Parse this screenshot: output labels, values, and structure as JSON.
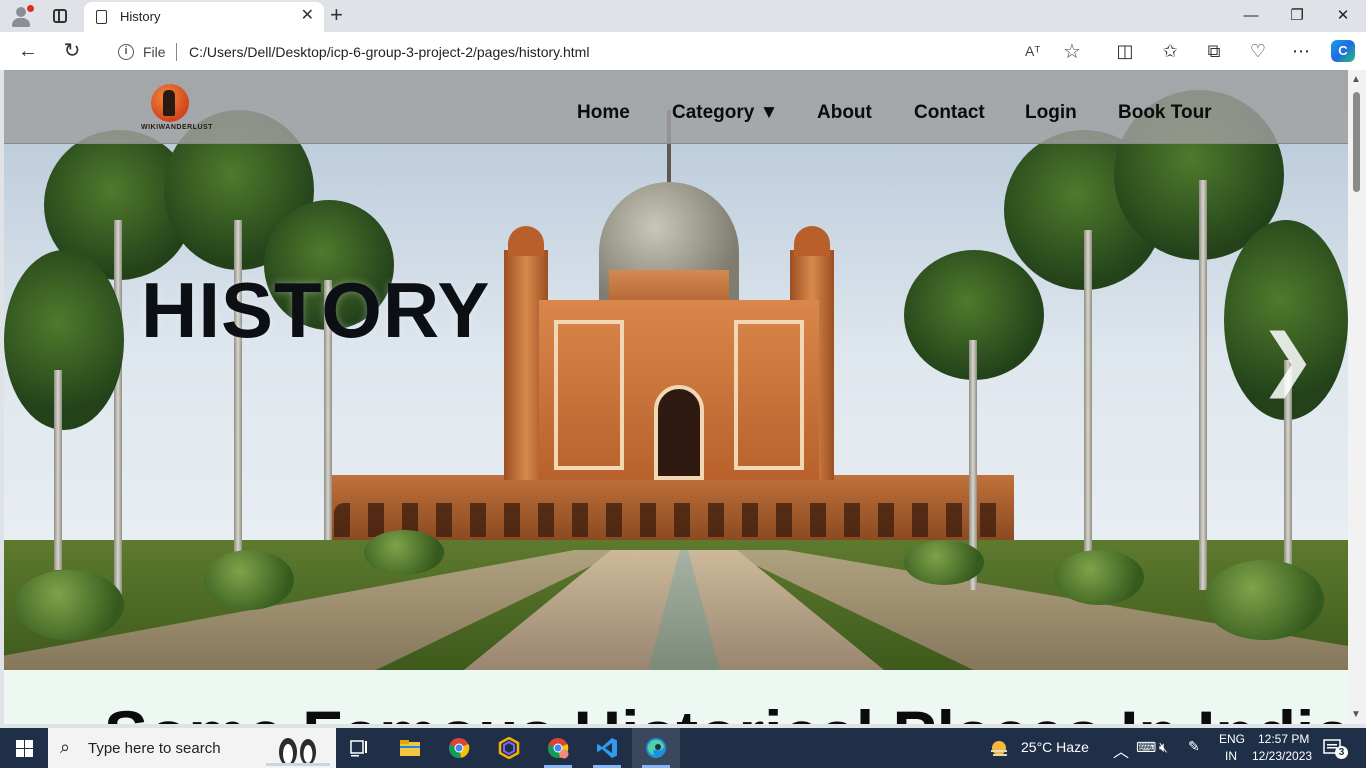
{
  "browser": {
    "tab_title": "History",
    "address_label": "File",
    "url": "C:/Users/Dell/Desktop/icp-6-group-3-project-2/pages/history.html",
    "read_aloud_label": "Aᵀ"
  },
  "site": {
    "logo_text": "WIKIWANDERLUST",
    "nav": {
      "home": "Home",
      "category": "Category ▼",
      "about": "About",
      "contact": "Contact",
      "login": "Login",
      "book_tour": "Book Tour"
    },
    "hero_title": "HISTORY",
    "next_arrow": "❯",
    "section_title": "Some Famous Historical Places In India"
  },
  "taskbar": {
    "search_placeholder": "Type here to search",
    "weather": "25°C  Haze",
    "lang_top": "ENG",
    "lang_bottom": "IN",
    "time": "12:57 PM",
    "date": "12/23/2023",
    "notifications": "3"
  },
  "colors": {
    "accent": "#0078d4",
    "navbar_bg": "#a0a0a0",
    "section_bg": "#eef8f3"
  }
}
